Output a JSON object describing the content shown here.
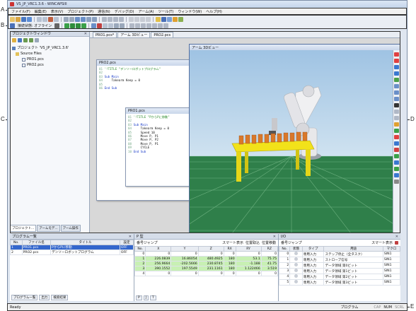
{
  "callouts": [
    "A",
    "B",
    "C",
    "D",
    "E"
  ],
  "window": {
    "title": "VS_JP_VRC1.3.6 - WINCAPSIII"
  },
  "menu": [
    "ファイル(F)",
    "編集(E)",
    "表示(V)",
    "プロジェクト(P)",
    "通信(N)",
    "デバッグ(D)",
    "アーム(A)",
    "ツール(T)",
    "ウィンドウ(W)",
    "ヘルプ(H)"
  ],
  "toolbar": {
    "connection_label": "接続状態: オフライン"
  },
  "project": {
    "title": "プロジェクトウィンドウ",
    "root": "プロジェクト 'VS_JP_VRC1.3.6'",
    "folder": "Source Files",
    "files": [
      "PRO1.pcs",
      "PRO2.pcs"
    ],
    "tabs": [
      "プロジェクト...",
      "アームモデ...",
      "アーム操作"
    ]
  },
  "doc_tabs": [
    "PRO1.pcs*",
    "アーム 3Dビュー",
    "PRO2.pcs"
  ],
  "editor1": {
    "title": "PRO2.pcs",
    "lines": [
      "'!TITLE \"デンソーロボットプログラム\"",
      "",
      "Sub Main",
      "    Takearm Keep = 0",
      "",
      "End Sub"
    ]
  },
  "editor2": {
    "title": "PRO1.pcs",
    "lines": [
      "'!TITLE \"PからPに移動\"",
      "",
      "Sub Main",
      "    Takearm Keep = 0",
      "    Speed 10",
      "    Move P, P1",
      "    Move P, P2",
      "    Move P, P1",
      "    CYCLE",
      "End Sub"
    ]
  },
  "view3d": {
    "title": "アーム 3Dビュー"
  },
  "program_list": {
    "title": "プログラム一覧",
    "columns": [
      "No.",
      "ファイル名",
      "タイトル",
      "設定"
    ],
    "rows": [
      [
        "1",
        "PRO1.pcs",
        "PからPに移動",
        "OFF"
      ],
      [
        "2",
        "PRO2.pcs",
        "デンソーロボットプログラム",
        "OFF"
      ]
    ],
    "tabs": [
      "プログラム一覧",
      "出力",
      "検索結果"
    ]
  },
  "p_var": {
    "title": "P 型",
    "jump_label": "番号ジャンプ",
    "smart_label": "スマート表示",
    "pos_label": "位置取込",
    "move_label": "位置移動",
    "columns": [
      "No.",
      "X",
      "Y",
      "Z",
      "RX",
      "RY",
      "RZ"
    ],
    "rows": [
      [
        "0",
        "0",
        "0",
        "0",
        "0",
        "0",
        "0"
      ],
      [
        "1",
        "226.0839",
        "16.86054",
        "480.4925",
        "180",
        "53.1",
        "75.75"
      ],
      [
        "2",
        "256.9664",
        "-202.5666",
        "230.8745",
        "180",
        "-1.188",
        "41.75"
      ],
      [
        "3",
        "390.1552",
        "197.5549",
        "231.1161",
        "180",
        "1.122466",
        "3.519"
      ],
      [
        "4",
        "0",
        "0",
        "0",
        "0",
        "0",
        "0"
      ]
    ],
    "tabs": [
      "P",
      "J",
      "T"
    ]
  },
  "io": {
    "title": "I/O",
    "jump_label": "番号ジャンプ",
    "smart_label": "スマート表示",
    "columns": [
      "No.",
      "状態",
      "タイプ",
      "用途",
      "マクロ"
    ],
    "rows": [
      [
        "0",
        "",
        "専用入力",
        "ステップ停止（全タスク）",
        "SIN1"
      ],
      [
        "1",
        "",
        "専用入力",
        "ストローブ信号",
        "SIN1"
      ],
      [
        "2",
        "",
        "専用入力",
        "データ領域 第0ビット",
        "SIN1"
      ],
      [
        "3",
        "",
        "専用入力",
        "データ領域 第1ビット",
        "SIN1"
      ],
      [
        "4",
        "",
        "専用入力",
        "データ領域 第2ビット",
        "SIN1"
      ],
      [
        "5",
        "",
        "専用入力",
        "データ領域 第3ビット",
        "SIN1"
      ]
    ]
  },
  "status": {
    "left": "Ready",
    "program": "プログラム",
    "cap": "CAP",
    "num": "NUM",
    "scrl": "SCRL"
  },
  "colors": {
    "green_row": "#c8f0b4",
    "selected": "#3366cc",
    "floor": "#2f7f4a"
  }
}
